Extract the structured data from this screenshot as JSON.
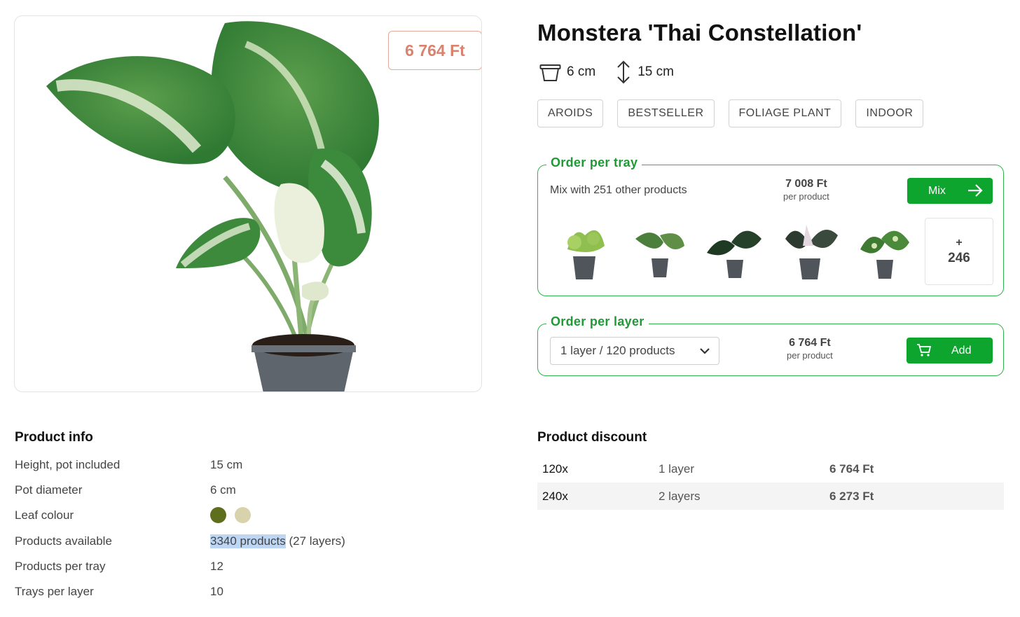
{
  "product": {
    "price_badge": "6 764 Ft",
    "title": "Monstera 'Thai Constellation'",
    "pot_size": "6 cm",
    "height": "15 cm",
    "tags": [
      "AROIDS",
      "BESTSELLER",
      "FOLIAGE PLANT",
      "INDOOR"
    ]
  },
  "order_tray": {
    "legend": "Order per tray",
    "mix_text": "Mix with 251 other products",
    "price": "7 008 Ft",
    "price_unit": "per product",
    "button_label": "Mix",
    "more_plus": "+",
    "more_count": "246"
  },
  "order_layer": {
    "legend": "Order per layer",
    "select_value": "1 layer / 120 products",
    "price": "6 764 Ft",
    "price_unit": "per product",
    "button_label": "Add"
  },
  "product_info": {
    "title": "Product info",
    "rows": [
      {
        "label": "Height, pot included",
        "value": "15 cm"
      },
      {
        "label": "Pot diameter",
        "value": "6 cm"
      },
      {
        "label": "Leaf colour",
        "value": ""
      },
      {
        "label": "Products available",
        "value": "3340 products",
        "extra": " (27 layers)"
      },
      {
        "label": "Products per tray",
        "value": "12"
      },
      {
        "label": "Trays per layer",
        "value": "10"
      }
    ],
    "leaf_colours": [
      "#5f6e1d",
      "#d8d3ac"
    ]
  },
  "discount": {
    "title": "Product discount",
    "rows": [
      {
        "qty": "120x",
        "unit": "1 layer",
        "price": "6 764 Ft"
      },
      {
        "qty": "240x",
        "unit": "2 layers",
        "price": "6 273 Ft"
      }
    ]
  },
  "colors": {
    "accent_green": "#0ea52f",
    "legend_green": "#1f9a36",
    "badge_salmon": "#d9826e"
  }
}
